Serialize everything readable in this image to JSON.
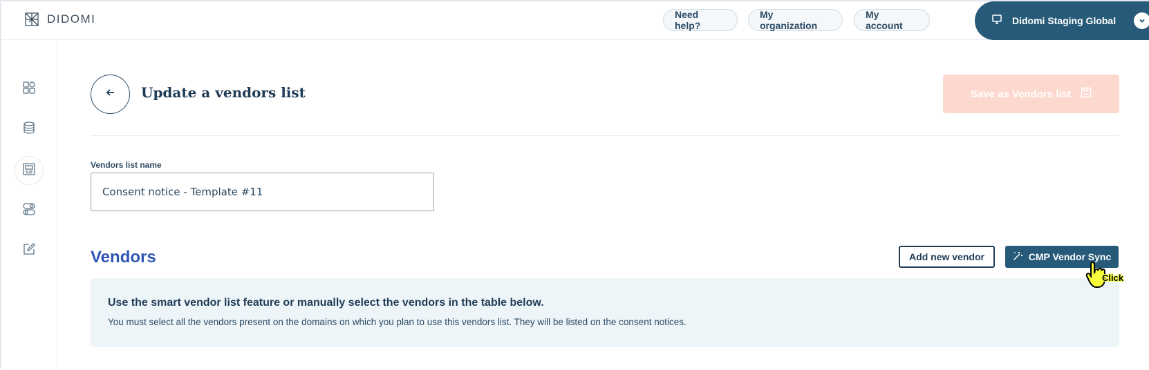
{
  "header": {
    "brand": "DIDOMI",
    "need_help": "Need help?",
    "my_organization": "My organization",
    "my_account": "My account",
    "organization_name": "Didomi Staging Global"
  },
  "sidebar": {
    "items": [
      {
        "icon": "dashboard-icon"
      },
      {
        "icon": "database-icon"
      },
      {
        "icon": "consent-notice-icon",
        "active": true
      },
      {
        "icon": "toggles-icon"
      },
      {
        "icon": "edit-icon"
      }
    ]
  },
  "page": {
    "title": "Update a vendors list",
    "save_label": "Save as Vendors list"
  },
  "form": {
    "name_label": "Vendors list name",
    "name_value": "Consent notice - Template #11"
  },
  "vendors": {
    "title": "Vendors",
    "add_label": "Add new vendor",
    "sync_label": "CMP Vendor Sync",
    "info_title": "Use the smart vendor list feature or manually select the vendors in the table below.",
    "info_text": "You must select all the vendors present on the domains on which you plan to use this vendors list. They will be listed on the consent notices."
  },
  "cursor": {
    "label": "Click"
  },
  "colors": {
    "primary": "#265a78",
    "section_title": "#2e56b3",
    "save_disabled": "#fdd8cf",
    "info_bg": "#eef5f9"
  }
}
